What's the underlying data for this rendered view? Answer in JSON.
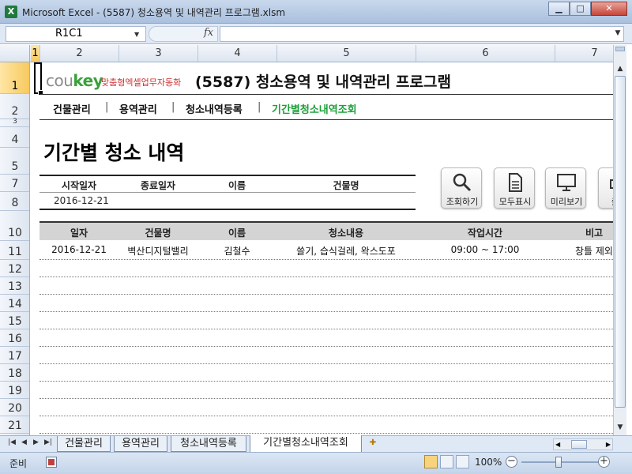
{
  "window": {
    "title": "Microsoft Excel - (5587) 청소용역 및 내역관리 프로그램.xlsm",
    "app_icon": "X",
    "minimize": "▁",
    "maximize": "□",
    "close": "✕"
  },
  "formula_bar": {
    "name_box": "R1C1",
    "fx": "fx",
    "formula": ""
  },
  "columns": [
    "1",
    "2",
    "3",
    "4",
    "5",
    "6",
    "7"
  ],
  "rows": [
    "1",
    "2",
    "3",
    "4",
    "5",
    "7",
    "8",
    "10",
    "11",
    "12",
    "13",
    "14",
    "15",
    "16",
    "17",
    "18",
    "19",
    "20",
    "21"
  ],
  "brand": {
    "logo_cou": "cou",
    "logo_key": "key",
    "tagline": "맞춤형엑셀업무자동화",
    "program_title": "(5587) 청소용역 및 내역관리 프로그램"
  },
  "nav": {
    "items": [
      {
        "label": "건물관리"
      },
      {
        "label": "용역관리"
      },
      {
        "label": "청소내역등록"
      },
      {
        "label": "기간별청소내역조회"
      }
    ],
    "separator": "|"
  },
  "page": {
    "heading": "기간별 청소 내역"
  },
  "filter": {
    "headers": [
      "시작일자",
      "종료일자",
      "이름",
      "건물명"
    ],
    "values": {
      "start_date": "2016-12-21",
      "end_date": "",
      "name": "",
      "building": ""
    }
  },
  "toolbar": {
    "search": "조회하기",
    "show_all": "모두표시",
    "preview": "미리보기",
    "print": "출력"
  },
  "table": {
    "headers": [
      "일자",
      "건물명",
      "이름",
      "청소내용",
      "작업시간",
      "비고"
    ],
    "rows": [
      {
        "date": "2016-12-21",
        "building": "벽산디지털밸리",
        "name": "김철수",
        "content": "쓸기, 습식걸레, 왁스도포",
        "time": "09:00 ~ 17:00",
        "note": "창틀 제외"
      }
    ]
  },
  "sheet_tabs": [
    "건물관리",
    "용역관리",
    "청소내역등록",
    "기간별청소내역조회"
  ],
  "active_tab_index": 3,
  "status": {
    "ready": "준비",
    "zoom": "100%",
    "zoom_minus": "−",
    "zoom_plus": "+"
  },
  "colors": {
    "accent_green": "#1aa038",
    "selected_header": "#f7c85d",
    "table_header_bg": "#d4d4d4"
  }
}
